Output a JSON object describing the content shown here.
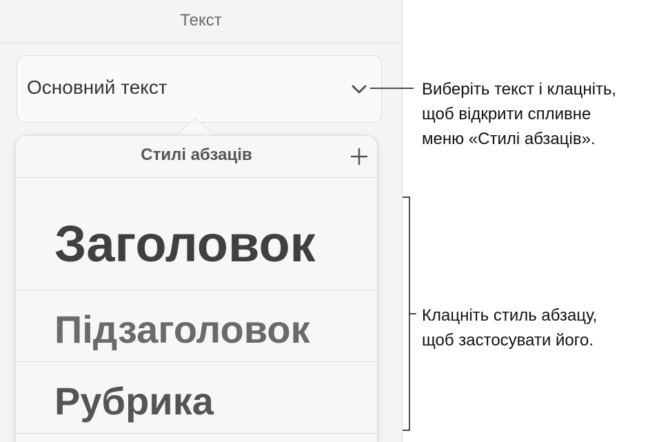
{
  "panel": {
    "title": "Текст",
    "current_style": "Основний текст"
  },
  "popover": {
    "title": "Стилі абзаців",
    "styles": [
      "Заголовок",
      "Підзаголовок",
      "Рубрика"
    ]
  },
  "callouts": {
    "select_lines": [
      "Виберіть текст і клацніть,",
      "щоб відкрити спливне",
      "меню «Стилі абзаців»."
    ],
    "apply_lines": [
      "Клацніть стиль абзацу,",
      "щоб застосувати його."
    ]
  },
  "icons": {
    "chevron": "chevron-down-icon",
    "add": "plus-icon"
  },
  "colors": {
    "panel_bg": "#f4f4f4",
    "divider": "#dadada",
    "text_dark": "#404040",
    "text_muted": "#6a6a6a"
  }
}
